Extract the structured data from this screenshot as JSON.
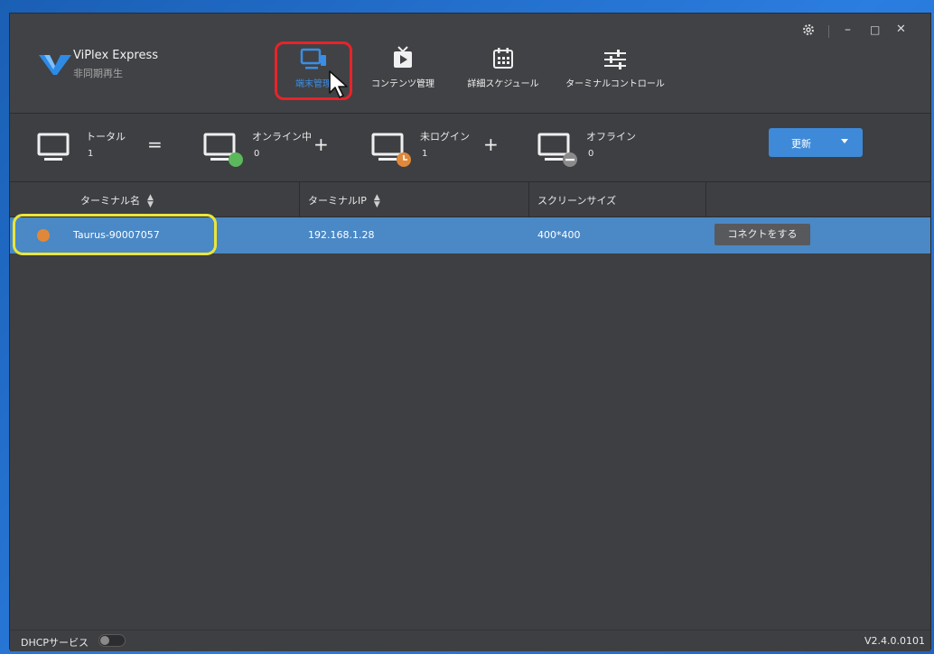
{
  "app": {
    "name": "ViPlex Express",
    "subtitle": "非同期再生",
    "version": "V2.4.0.0101"
  },
  "nav": [
    {
      "label": "端末管理",
      "icon": "monitor-icon",
      "active": true
    },
    {
      "label": "コンテンツ管理",
      "icon": "play-tv-icon",
      "active": false
    },
    {
      "label": "詳細スケジュール",
      "icon": "calendar-icon",
      "active": false
    },
    {
      "label": "ターミナルコントロール",
      "icon": "sliders-icon",
      "active": false
    }
  ],
  "window_controls": {
    "settings_icon": "gear-icon",
    "minimize": "–",
    "maximize": "□",
    "close": "✕"
  },
  "stats": {
    "total": {
      "label": "トータル",
      "count": "1"
    },
    "eq": "=",
    "online": {
      "label": "オンライン中",
      "count": "0",
      "color": "#5cb85c"
    },
    "plus1": "+",
    "not_logged_in": {
      "label": "未ログイン",
      "count": "1",
      "color": "#e0883a"
    },
    "plus2": "+",
    "offline": {
      "label": "オフライン",
      "count": "0",
      "color": "#8a8a8a"
    }
  },
  "refresh_button": {
    "label": "更新"
  },
  "table": {
    "columns": [
      "ターミナル名",
      "ターミナルIP",
      "スクリーンサイズ"
    ],
    "rows": [
      {
        "status_color": "#e0883a",
        "name": "Taurus-90007057",
        "ip": "192.168.1.28",
        "size": "400*400",
        "action": "コネクトをする"
      }
    ]
  },
  "status_bar": {
    "dhcp_label": "DHCPサービス",
    "dhcp_on": false
  },
  "colors": {
    "accent": "#3e8ad8",
    "selected_row": "#4a88c6",
    "highlight_red": "#e8232a",
    "highlight_yellow": "#eae63a"
  }
}
